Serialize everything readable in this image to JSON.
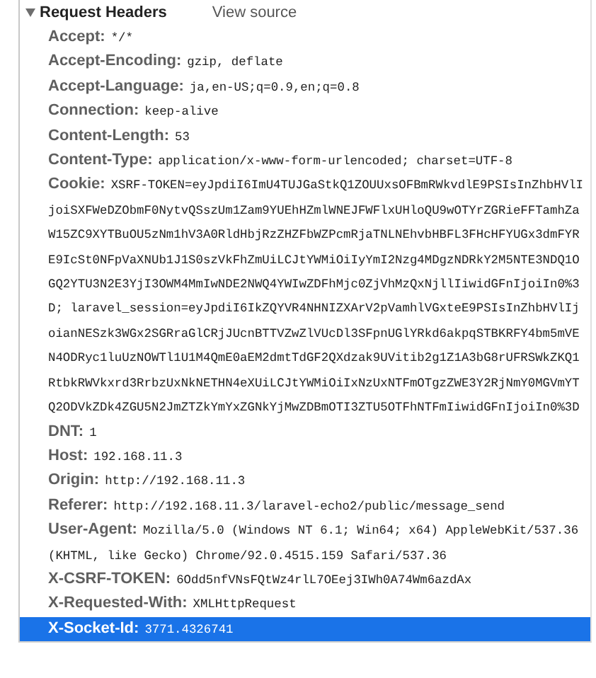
{
  "section": {
    "title": "Request Headers",
    "expanded": true,
    "view_source": "View source"
  },
  "headers": [
    {
      "name": "Accept:",
      "value": "*/*",
      "selected": false
    },
    {
      "name": "Accept-Encoding:",
      "value": "gzip, deflate",
      "selected": false
    },
    {
      "name": "Accept-Language:",
      "value": "ja,en-US;q=0.9,en;q=0.8",
      "selected": false
    },
    {
      "name": "Connection:",
      "value": "keep-alive",
      "selected": false
    },
    {
      "name": "Content-Length:",
      "value": "53",
      "selected": false
    },
    {
      "name": "Content-Type:",
      "value": "application/x-www-form-urlencoded; charset=UTF-8",
      "selected": false
    },
    {
      "name": "Cookie:",
      "value": "XSRF-TOKEN=eyJpdiI6ImU4TUJGaStkQ1ZOUUxsOFBmRWkvdlE9PSIsInZhbHVlIjoiSXFWeDZObmF0NytvQSszUm1Zam9YUEhHZmlWNEJFWFlxUHloQU9wOTYrZGRieFFTamhZaW15ZC9XYTBuOU5zNm1hV3A0RldHbjRzZHZFbWZPcmRjaTNLNEhvbHBFL3FHcHFYUGx3dmFYRE9IcSt0NFpVaXNUb1J1S0szVkFhZmUiLCJtYWMiOiIyYmI2Nzg4MDgzNDRkY2M5NTE3NDQ1OGQ2YTU3N2E3YjI3OWM4MmIwNDE2NWQ4YWIwZDFhMjc0ZjVhMzQxNjllIiwidGFnIjoiIn0%3D; laravel_session=eyJpdiI6IkZQYVR4NHNIZXArV2pVamhlVGxteE9PSIsInZhbHVlIjoianNESzk3WGx2SGRraGlCRjJUcnBTTVZwZlVUcDl3SFpnUGlYRkd6akpqSTBKRFY4bm5mVEN4ODRyc1luUzNOWTl1U1M4QmE0aEM2dmtTdGF2QXdzak9UVitib2g1Z1A3bG8rUFRSWkZKQ1RtbkRWVkxrd3RrbzUxNkNETHN4eXUiLCJtYWMiOiIxNzUxNTFmOTgzZWE3Y2RjNmY0MGVmYTQ2ODVkZDk4ZGU5N2JmZTZkYmYxZGNkYjMwZDBmOTI3ZTU5OTFhNTFmIiwidGFnIjoiIn0%3D",
      "selected": false
    },
    {
      "name": "DNT:",
      "value": "1",
      "selected": false
    },
    {
      "name": "Host:",
      "value": "192.168.11.3",
      "selected": false
    },
    {
      "name": "Origin:",
      "value": "http://192.168.11.3",
      "selected": false
    },
    {
      "name": "Referer:",
      "value": "http://192.168.11.3/laravel-echo2/public/message_send",
      "selected": false
    },
    {
      "name": "User-Agent:",
      "value": "Mozilla/5.0 (Windows NT 6.1; Win64; x64) AppleWebKit/537.36 (KHTML, like Gecko) Chrome/92.0.4515.159 Safari/537.36",
      "selected": false
    },
    {
      "name": "X-CSRF-TOKEN:",
      "value": "6Odd5nfVNsFQtWz4rlL7OEej3IWh0A74Wm6azdAx",
      "selected": false
    },
    {
      "name": "X-Requested-With:",
      "value": "XMLHttpRequest",
      "selected": false
    },
    {
      "name": "X-Socket-Id:",
      "value": "3771.4326741",
      "selected": true
    }
  ]
}
